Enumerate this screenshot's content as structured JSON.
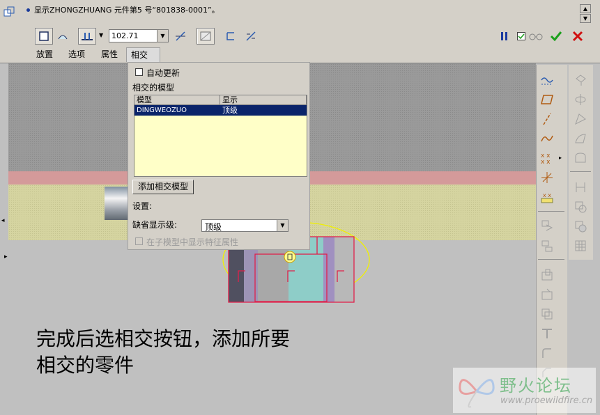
{
  "dashboard": {
    "prompt": "显示ZHONGZHUANG 元件第5 号“801838-0001”。",
    "depth_value": "102.71",
    "tabs": [
      "放置",
      "选项",
      "属性",
      "相交"
    ],
    "colors": {
      "accept": "#1ba01b",
      "cancel": "#d01010",
      "pause": "#1a3aa0"
    }
  },
  "panel": {
    "auto_update_label": "自动更新",
    "intersected_models_heading": "相交的模型",
    "table": {
      "headers": [
        "模型",
        "显示"
      ],
      "rows": [
        {
          "model": "DINGWEOZUO",
          "display": "顶级"
        }
      ]
    },
    "add_button": "添加相交模型",
    "settings_label": "设置:",
    "default_level_label": "缺省显示级:",
    "default_level_value": "顶级",
    "show_features_label": "在子模型中显示特征属性"
  },
  "annotation": {
    "line1": "完成后选相交按钮，添加所要",
    "line2": "相交的零件"
  },
  "watermark": {
    "title": "野火论坛",
    "url": "www.proewildfire.cn"
  },
  "icons": {
    "dashboard": [
      "solid-icon",
      "surface-icon",
      "depth-option-icon",
      "flip-depth-icon",
      "remove-material-icon",
      "thicken-icon",
      "flip-thicken-icon",
      "pause-icon",
      "preview-checkbox-icon",
      "glasses-icon",
      "accept-icon",
      "cancel-icon"
    ],
    "right_toolbar": [
      "datum-plane-display-icon",
      "datum-plane-icon",
      "datum-axis-icon",
      "datum-curve-icon",
      "datum-point-icon",
      "coordinate-system-icon",
      "analysis-icon"
    ]
  }
}
